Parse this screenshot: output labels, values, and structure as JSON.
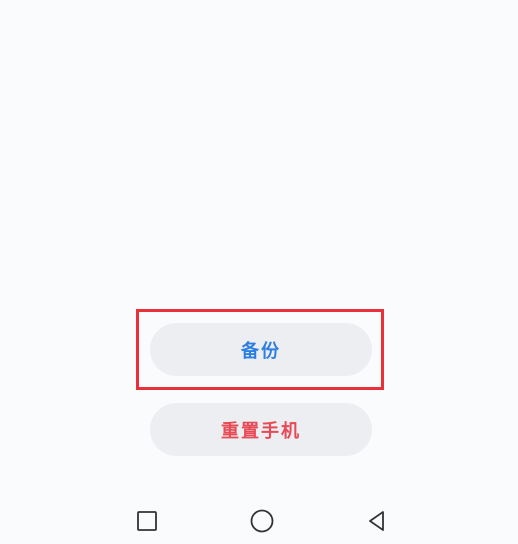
{
  "actions": {
    "backup_label": "备份",
    "reset_label": "重置手机"
  },
  "colors": {
    "backup_text": "#2f7fe0",
    "reset_text": "#e84a55",
    "button_bg": "#eceef2",
    "highlight": "#e8303a"
  },
  "navbar": {
    "icons": [
      "square-recent-icon",
      "circle-home-icon",
      "triangle-back-icon"
    ]
  }
}
